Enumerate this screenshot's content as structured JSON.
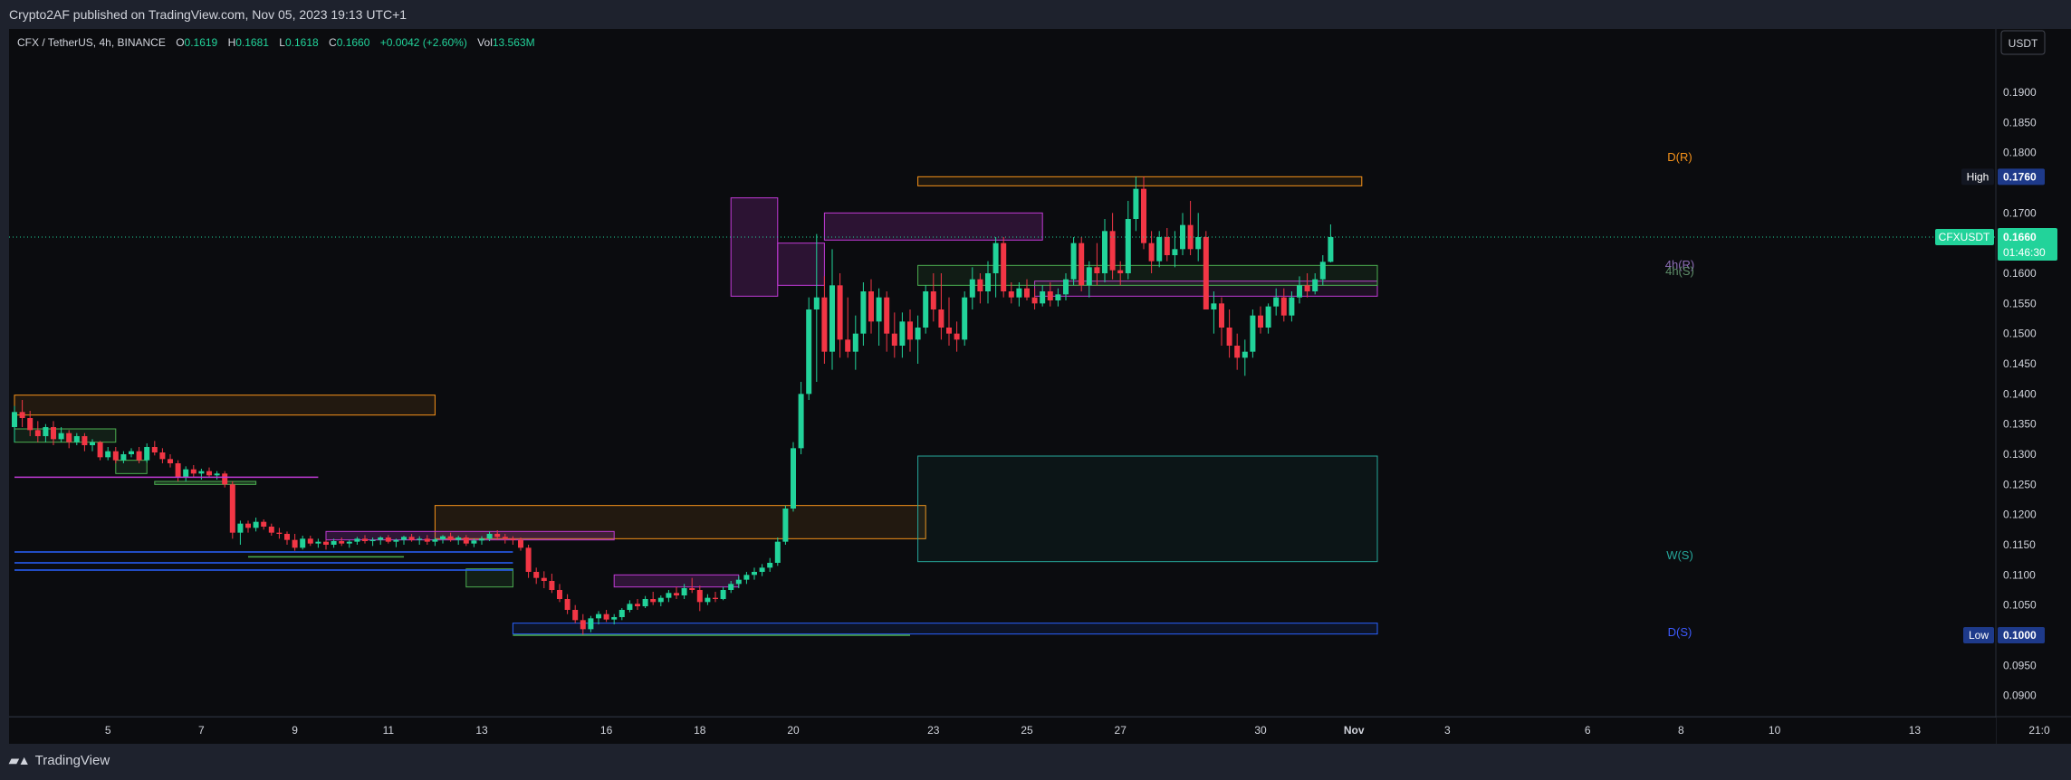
{
  "publish_note": "Crypto2AF published on TradingView.com, Nov 05, 2023 19:13 UTC+1",
  "brand": "TradingView",
  "legend": {
    "symbol": "CFX / TetherUS, 4h, BINANCE",
    "o_label": "O",
    "o_value": "0.1619",
    "h_label": "H",
    "h_value": "0.1681",
    "l_label": "L",
    "l_value": "0.1618",
    "c_label": "C",
    "c_value": "0.1660",
    "change": "+0.0042 (+2.60%)",
    "vol_label": "Vol",
    "vol_value": "13.563M"
  },
  "currency_button": "USDT",
  "colors": {
    "up": "#22d39a",
    "down": "#f23645",
    "bg": "#0b0c0f",
    "panel": "#1e222d",
    "orange": "#f7931a",
    "purple": "#c13ad6",
    "green_box": "#4caf50",
    "teal": "#26a69a",
    "blue": "#2962ff"
  },
  "chart_data": {
    "type": "candlestick",
    "symbol": "CFXUSDT",
    "timeframe": "4h",
    "ylim": [
      0.0865,
      0.2005
    ],
    "y_ticks": [
      "0.1900",
      "0.1850",
      "0.1800",
      "0.1700",
      "0.1650",
      "0.1600",
      "0.1550",
      "0.1500",
      "0.1450",
      "0.1400",
      "0.1350",
      "0.1300",
      "0.1250",
      "0.1200",
      "0.1150",
      "0.1100",
      "0.1050",
      "0.0950",
      "0.0900"
    ],
    "x_ticks": [
      "5",
      "7",
      "9",
      "11",
      "13",
      "16",
      "18",
      "20",
      "23",
      "25",
      "27",
      "30",
      "Nov",
      "3",
      "6",
      "8",
      "10",
      "13",
      "21:0"
    ],
    "x_tick_slots": [
      12,
      24,
      36,
      48,
      60,
      76,
      88,
      100,
      118,
      130,
      142,
      160,
      172,
      184,
      202,
      214,
      226,
      244,
      260
    ],
    "last_price": "0.1660",
    "countdown": "01:46:30",
    "high_label": "High",
    "high_value": "0.1760",
    "low_label": "Low",
    "low_value": "0.1000",
    "zone_labels": {
      "d_r": "D(R)",
      "h4_r": "4h(R)",
      "h4_s": "4h(S)",
      "w_s": "W(S)",
      "d_s": "D(S)"
    },
    "candles": [
      [
        0.1345,
        0.138,
        0.132,
        0.137
      ],
      [
        0.137,
        0.139,
        0.1345,
        0.136
      ],
      [
        0.136,
        0.1372,
        0.133,
        0.134
      ],
      [
        0.134,
        0.1355,
        0.132,
        0.133
      ],
      [
        0.133,
        0.135,
        0.132,
        0.1345
      ],
      [
        0.1345,
        0.1355,
        0.1315,
        0.1325
      ],
      [
        0.1325,
        0.1345,
        0.132,
        0.1335
      ],
      [
        0.1335,
        0.134,
        0.131,
        0.132
      ],
      [
        0.132,
        0.1335,
        0.1315,
        0.133
      ],
      [
        0.133,
        0.1335,
        0.1305,
        0.1315
      ],
      [
        0.1315,
        0.1325,
        0.1305,
        0.132
      ],
      [
        0.132,
        0.1322,
        0.129,
        0.1295
      ],
      [
        0.1295,
        0.1312,
        0.129,
        0.1305
      ],
      [
        0.1305,
        0.1312,
        0.1285,
        0.129
      ],
      [
        0.129,
        0.1305,
        0.1285,
        0.13
      ],
      [
        0.13,
        0.131,
        0.1295,
        0.1305
      ],
      [
        0.1305,
        0.1312,
        0.1285,
        0.129
      ],
      [
        0.129,
        0.1318,
        0.1286,
        0.1312
      ],
      [
        0.1312,
        0.1322,
        0.1298,
        0.1303
      ],
      [
        0.1303,
        0.131,
        0.1285,
        0.1292
      ],
      [
        0.1292,
        0.13,
        0.1278,
        0.1285
      ],
      [
        0.1285,
        0.129,
        0.1255,
        0.1262
      ],
      [
        0.1262,
        0.128,
        0.1255,
        0.1275
      ],
      [
        0.1275,
        0.1282,
        0.1262,
        0.1268
      ],
      [
        0.1268,
        0.1276,
        0.1258,
        0.1272
      ],
      [
        0.1272,
        0.1278,
        0.1262,
        0.1265
      ],
      [
        0.1265,
        0.1272,
        0.1258,
        0.1268
      ],
      [
        0.1268,
        0.1272,
        0.1245,
        0.125
      ],
      [
        0.125,
        0.1255,
        0.116,
        0.117
      ],
      [
        0.117,
        0.119,
        0.115,
        0.1185
      ],
      [
        0.1185,
        0.119,
        0.117,
        0.1178
      ],
      [
        0.1178,
        0.1195,
        0.1172,
        0.1188
      ],
      [
        0.1188,
        0.1192,
        0.1175,
        0.118
      ],
      [
        0.118,
        0.1185,
        0.1165,
        0.117
      ],
      [
        0.117,
        0.1178,
        0.116,
        0.1168
      ],
      [
        0.1168,
        0.1172,
        0.115,
        0.1158
      ],
      [
        0.1158,
        0.1168,
        0.114,
        0.1145
      ],
      [
        0.1145,
        0.1165,
        0.1142,
        0.116
      ],
      [
        0.116,
        0.1165,
        0.1148,
        0.1152
      ],
      [
        0.1152,
        0.116,
        0.1145,
        0.1155
      ],
      [
        0.1155,
        0.1158,
        0.1142,
        0.115
      ],
      [
        0.115,
        0.116,
        0.1145,
        0.1156
      ],
      [
        0.1156,
        0.1162,
        0.1148,
        0.1152
      ],
      [
        0.1152,
        0.1158,
        0.1145,
        0.1155
      ],
      [
        0.1155,
        0.1163,
        0.115,
        0.116
      ],
      [
        0.116,
        0.1166,
        0.1152,
        0.1156
      ],
      [
        0.1156,
        0.1162,
        0.1148,
        0.1158
      ],
      [
        0.1158,
        0.1164,
        0.115,
        0.1162
      ],
      [
        0.1162,
        0.1166,
        0.1152,
        0.1155
      ],
      [
        0.1155,
        0.116,
        0.1146,
        0.1158
      ],
      [
        0.1158,
        0.1165,
        0.115,
        0.1163
      ],
      [
        0.1163,
        0.1168,
        0.1155,
        0.1158
      ],
      [
        0.1158,
        0.1164,
        0.115,
        0.116
      ],
      [
        0.116,
        0.1166,
        0.115,
        0.1155
      ],
      [
        0.1155,
        0.1162,
        0.1148,
        0.1159
      ],
      [
        0.1159,
        0.1166,
        0.1152,
        0.1164
      ],
      [
        0.1164,
        0.117,
        0.1155,
        0.1158
      ],
      [
        0.1158,
        0.1165,
        0.115,
        0.1162
      ],
      [
        0.1162,
        0.1166,
        0.1148,
        0.1152
      ],
      [
        0.1152,
        0.116,
        0.1146,
        0.1157
      ],
      [
        0.1157,
        0.1164,
        0.115,
        0.116
      ],
      [
        0.116,
        0.1172,
        0.1156,
        0.1168
      ],
      [
        0.1168,
        0.1174,
        0.1158,
        0.1163
      ],
      [
        0.1163,
        0.1168,
        0.1152,
        0.116
      ],
      [
        0.116,
        0.1164,
        0.115,
        0.1158
      ],
      [
        0.1158,
        0.1162,
        0.114,
        0.1145
      ],
      [
        0.1145,
        0.115,
        0.1095,
        0.1105
      ],
      [
        0.1105,
        0.1112,
        0.1085,
        0.1095
      ],
      [
        0.1095,
        0.1106,
        0.1078,
        0.109
      ],
      [
        0.109,
        0.1102,
        0.107,
        0.1075
      ],
      [
        0.1075,
        0.1085,
        0.1055,
        0.106
      ],
      [
        0.106,
        0.1068,
        0.1035,
        0.1042
      ],
      [
        0.1042,
        0.105,
        0.102,
        0.1025
      ],
      [
        0.1025,
        0.1035,
        0.1,
        0.101
      ],
      [
        0.101,
        0.1032,
        0.1005,
        0.1028
      ],
      [
        0.1028,
        0.104,
        0.1018,
        0.1035
      ],
      [
        0.1035,
        0.1042,
        0.1022,
        0.1026
      ],
      [
        0.1026,
        0.1035,
        0.1018,
        0.103
      ],
      [
        0.103,
        0.1045,
        0.1025,
        0.1042
      ],
      [
        0.1042,
        0.1058,
        0.1038,
        0.1052
      ],
      [
        0.1052,
        0.106,
        0.1042,
        0.1048
      ],
      [
        0.1048,
        0.1065,
        0.1045,
        0.106
      ],
      [
        0.106,
        0.1072,
        0.105,
        0.1055
      ],
      [
        0.1055,
        0.1066,
        0.1048,
        0.1062
      ],
      [
        0.1062,
        0.1075,
        0.1055,
        0.107
      ],
      [
        0.107,
        0.108,
        0.106,
        0.1066
      ],
      [
        0.1066,
        0.1085,
        0.106,
        0.1078
      ],
      [
        0.1078,
        0.1095,
        0.107,
        0.1075
      ],
      [
        0.1075,
        0.1082,
        0.104,
        0.1055
      ],
      [
        0.1055,
        0.1068,
        0.105,
        0.1062
      ],
      [
        0.1062,
        0.1072,
        0.1055,
        0.106
      ],
      [
        0.106,
        0.108,
        0.1058,
        0.1075
      ],
      [
        0.1075,
        0.109,
        0.107,
        0.1085
      ],
      [
        0.1085,
        0.1098,
        0.1078,
        0.1092
      ],
      [
        0.1092,
        0.1105,
        0.1085,
        0.11
      ],
      [
        0.11,
        0.1112,
        0.1092,
        0.1105
      ],
      [
        0.1105,
        0.1118,
        0.1098,
        0.1112
      ],
      [
        0.1112,
        0.1128,
        0.1105,
        0.112
      ],
      [
        0.112,
        0.1162,
        0.1115,
        0.1155
      ],
      [
        0.1155,
        0.1215,
        0.115,
        0.121
      ],
      [
        0.121,
        0.132,
        0.1205,
        0.131
      ],
      [
        0.131,
        0.142,
        0.13,
        0.14
      ],
      [
        0.14,
        0.156,
        0.139,
        0.154
      ],
      [
        0.154,
        0.1665,
        0.142,
        0.156
      ],
      [
        0.156,
        0.1595,
        0.145,
        0.147
      ],
      [
        0.147,
        0.164,
        0.144,
        0.158
      ],
      [
        0.158,
        0.16,
        0.146,
        0.149
      ],
      [
        0.149,
        0.156,
        0.146,
        0.147
      ],
      [
        0.147,
        0.153,
        0.144,
        0.15
      ],
      [
        0.15,
        0.1585,
        0.148,
        0.157
      ],
      [
        0.157,
        0.159,
        0.15,
        0.152
      ],
      [
        0.152,
        0.1575,
        0.148,
        0.156
      ],
      [
        0.156,
        0.157,
        0.147,
        0.15
      ],
      [
        0.15,
        0.1535,
        0.146,
        0.148
      ],
      [
        0.148,
        0.1535,
        0.146,
        0.152
      ],
      [
        0.152,
        0.154,
        0.147,
        0.149
      ],
      [
        0.149,
        0.153,
        0.145,
        0.151
      ],
      [
        0.151,
        0.158,
        0.15,
        0.157
      ],
      [
        0.157,
        0.16,
        0.152,
        0.154
      ],
      [
        0.154,
        0.16,
        0.149,
        0.151
      ],
      [
        0.151,
        0.156,
        0.148,
        0.15
      ],
      [
        0.15,
        0.152,
        0.147,
        0.149
      ],
      [
        0.149,
        0.157,
        0.148,
        0.156
      ],
      [
        0.156,
        0.161,
        0.154,
        0.159
      ],
      [
        0.159,
        0.16,
        0.155,
        0.157
      ],
      [
        0.157,
        0.162,
        0.155,
        0.16
      ],
      [
        0.16,
        0.166,
        0.156,
        0.165
      ],
      [
        0.165,
        0.166,
        0.156,
        0.157
      ],
      [
        0.157,
        0.1585,
        0.155,
        0.156
      ],
      [
        0.156,
        0.1585,
        0.1545,
        0.1575
      ],
      [
        0.1575,
        0.159,
        0.1555,
        0.156
      ],
      [
        0.156,
        0.1575,
        0.154,
        0.155
      ],
      [
        0.155,
        0.158,
        0.1545,
        0.157
      ],
      [
        0.157,
        0.1585,
        0.1545,
        0.1555
      ],
      [
        0.1555,
        0.1575,
        0.1545,
        0.1565
      ],
      [
        0.1565,
        0.16,
        0.1555,
        0.159
      ],
      [
        0.159,
        0.166,
        0.158,
        0.165
      ],
      [
        0.165,
        0.166,
        0.157,
        0.158
      ],
      [
        0.158,
        0.162,
        0.156,
        0.161
      ],
      [
        0.161,
        0.165,
        0.158,
        0.16
      ],
      [
        0.16,
        0.169,
        0.1585,
        0.167
      ],
      [
        0.167,
        0.17,
        0.159,
        0.1605
      ],
      [
        0.1605,
        0.162,
        0.158,
        0.16
      ],
      [
        0.16,
        0.172,
        0.159,
        0.169
      ],
      [
        0.169,
        0.176,
        0.167,
        0.174
      ],
      [
        0.174,
        0.176,
        0.164,
        0.165
      ],
      [
        0.165,
        0.167,
        0.16,
        0.162
      ],
      [
        0.162,
        0.167,
        0.161,
        0.166
      ],
      [
        0.166,
        0.1675,
        0.162,
        0.163
      ],
      [
        0.163,
        0.167,
        0.161,
        0.164
      ],
      [
        0.164,
        0.17,
        0.163,
        0.168
      ],
      [
        0.168,
        0.172,
        0.163,
        0.164
      ],
      [
        0.164,
        0.17,
        0.162,
        0.166
      ],
      [
        0.166,
        0.167,
        0.156,
        0.154
      ],
      [
        0.154,
        0.157,
        0.15,
        0.155
      ],
      [
        0.155,
        0.156,
        0.148,
        0.151
      ],
      [
        0.151,
        0.154,
        0.146,
        0.148
      ],
      [
        0.148,
        0.15,
        0.144,
        0.146
      ],
      [
        0.146,
        0.149,
        0.143,
        0.147
      ],
      [
        0.147,
        0.154,
        0.146,
        0.153
      ],
      [
        0.153,
        0.1545,
        0.15,
        0.151
      ],
      [
        0.151,
        0.155,
        0.15,
        0.1545
      ],
      [
        0.1545,
        0.1575,
        0.153,
        0.156
      ],
      [
        0.156,
        0.1575,
        0.152,
        0.153
      ],
      [
        0.153,
        0.157,
        0.152,
        0.156
      ],
      [
        0.156,
        0.1595,
        0.155,
        0.158
      ],
      [
        0.158,
        0.16,
        0.156,
        0.157
      ],
      [
        0.157,
        0.16,
        0.1565,
        0.159
      ],
      [
        0.159,
        0.163,
        0.158,
        0.1619
      ],
      [
        0.1619,
        0.1681,
        0.1618,
        0.166
      ]
    ]
  }
}
